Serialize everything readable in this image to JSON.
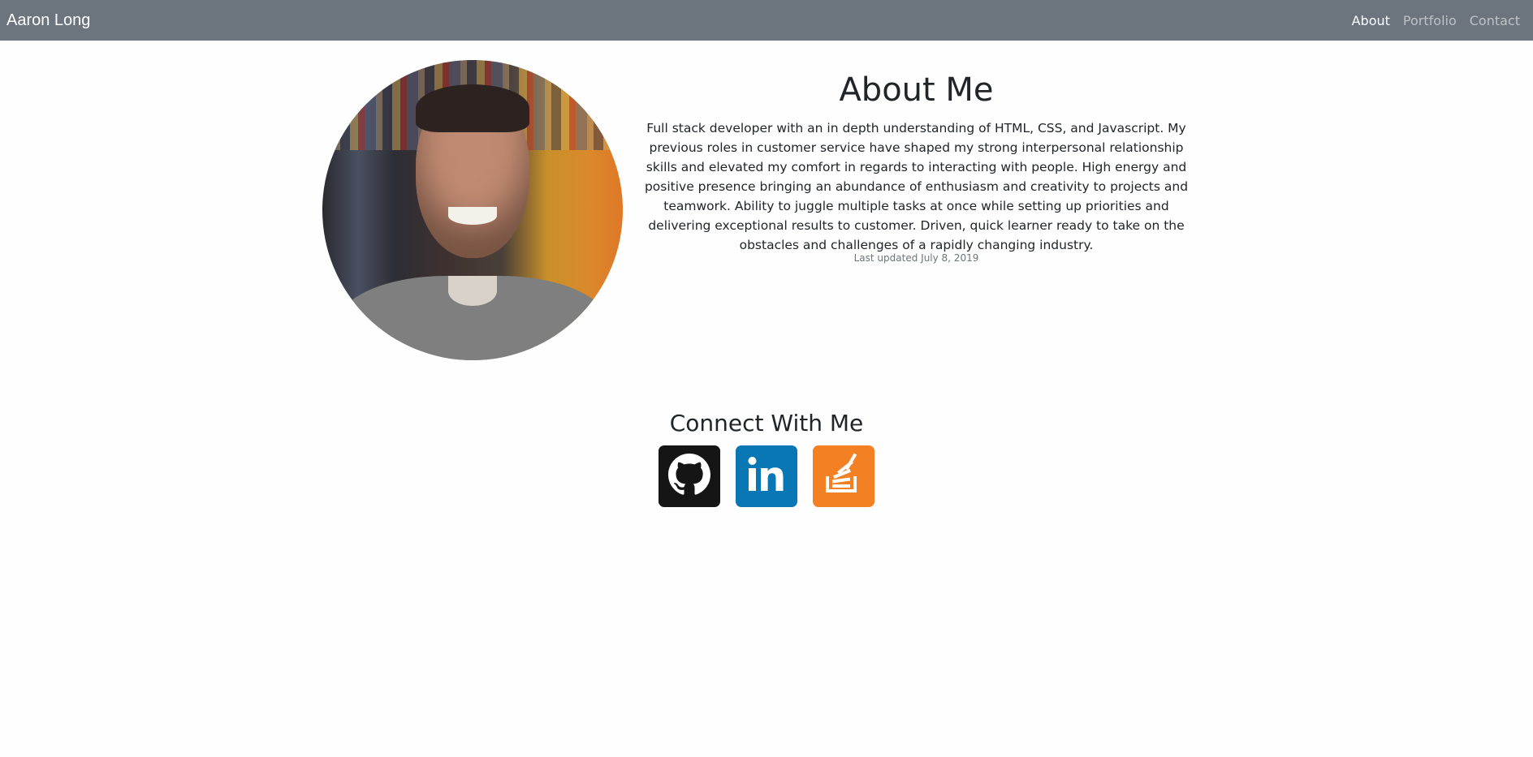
{
  "navbar": {
    "brand": "Aaron Long",
    "links": [
      {
        "label": "About",
        "active": true
      },
      {
        "label": "Portfolio",
        "active": false
      },
      {
        "label": "Contact",
        "active": false
      }
    ]
  },
  "about": {
    "title": "About Me",
    "text": "Full stack developer with an in depth understanding of HTML, CSS, and Javascript. My previous roles in customer service have shaped my strong interpersonal relationship skills and elevated my comfort in regards to interacting with people. High energy and positive presence bringing an abundance of enthusiasm and creativity to projects and teamwork. Ability to juggle multiple tasks at once while setting up priorities and delivering exceptional results to customer. Driven, quick learner ready to take on the obstacles and challenges of a rapidly changing industry.",
    "updated": "Last updated July 8, 2019"
  },
  "connect": {
    "title": "Connect With Me",
    "icons": [
      "github-icon",
      "linkedin-icon",
      "stackoverflow-icon"
    ]
  },
  "colors": {
    "navbar": "#6c757d",
    "github": "#151515",
    "linkedin": "#0a77b5",
    "stackoverflow": "#f48024"
  }
}
